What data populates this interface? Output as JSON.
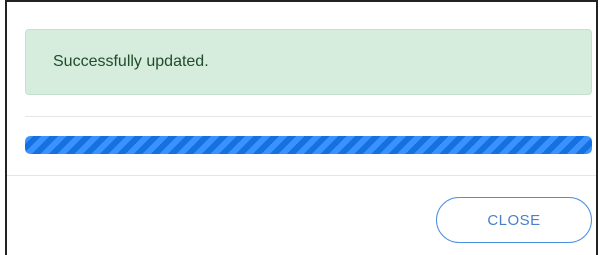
{
  "alert": {
    "message": "Successfully updated.",
    "status": "success",
    "background_color": "#d6ecdc",
    "text_color": "#1f4d2c"
  },
  "progress": {
    "value_percent": 100,
    "style": "striped",
    "color": "#1a7cf2"
  },
  "footer": {
    "close_label": "CLOSE",
    "close_color": "#4a90e2"
  }
}
